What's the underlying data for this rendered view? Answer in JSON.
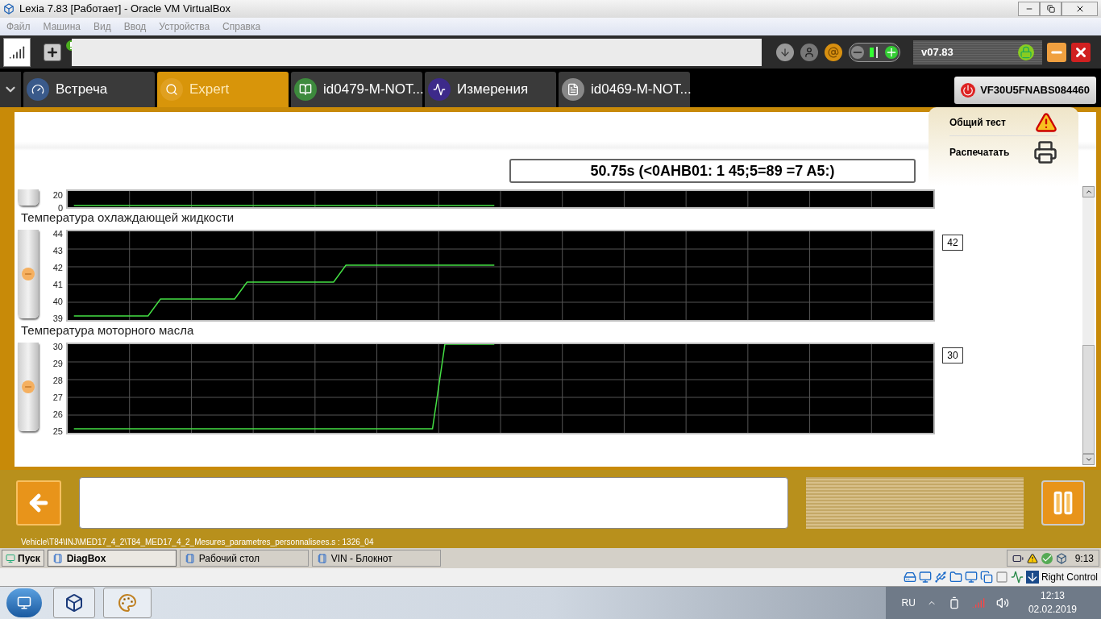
{
  "window": {
    "title": "Lexia 7.83 [Работает] - Oracle VM VirtualBox"
  },
  "menu": [
    "Файл",
    "Машина",
    "Вид",
    "Ввод",
    "Устройства",
    "Справка"
  ],
  "toolbar": {
    "version": "v07.83"
  },
  "tabs": [
    {
      "label": "Встреча",
      "selected": false
    },
    {
      "label": "Expert",
      "selected": true
    },
    {
      "label": "id0479-M-NOT...",
      "selected": false
    },
    {
      "label": "Измерения",
      "selected": false
    },
    {
      "label": "id0469-M-NOT...",
      "selected": false
    }
  ],
  "vin": "VF30U5FNABS084460",
  "actions": [
    "Общий тест",
    "Распечатать"
  ],
  "timestamp": "50.75s (<0AHB01: 1 45;5=89 =7 A5:)",
  "charts": [
    {
      "chart_data": {
        "type": "line",
        "categories": [
          null,
          null,
          null,
          null,
          null,
          null,
          null,
          null,
          null,
          null,
          null,
          null,
          null,
          null,
          null,
          null,
          null,
          null,
          null,
          null,
          null,
          null,
          null,
          null,
          null,
          null,
          null,
          null,
          null,
          null,
          null,
          null,
          null,
          null,
          null,
          null,
          null,
          null,
          null,
          null,
          null,
          null,
          null,
          null,
          null,
          null,
          null,
          null,
          null,
          null,
          null,
          null,
          null,
          null,
          null,
          null,
          null,
          null,
          null,
          null,
          null,
          null,
          null,
          null,
          null,
          null,
          null,
          null,
          null,
          null
        ],
        "ylim": [
          0,
          20
        ],
        "grid": true,
        "yticks": [
          {
            "value": 0,
            "label": "0"
          },
          {
            "value": 20,
            "label": "20"
          }
        ],
        "series": [
          {
            "color": "#44e044",
            "values": [
              0,
              0,
              0,
              0,
              0,
              0,
              0,
              0,
              0,
              0,
              0,
              0,
              0,
              0,
              0,
              0,
              0,
              0,
              0,
              0,
              0,
              0,
              0,
              0,
              0,
              0,
              0,
              0,
              0,
              0,
              0,
              0,
              0,
              0,
              0,
              null,
              null,
              null,
              null,
              null,
              null,
              null,
              null,
              null,
              null,
              null,
              null,
              null,
              null,
              null,
              null,
              null,
              null,
              null,
              null,
              null,
              null,
              null,
              null,
              null,
              null,
              null,
              null,
              null,
              null,
              null,
              null,
              null,
              null,
              null
            ]
          }
        ]
      }
    },
    {
      "reading": "42",
      "chart_data": {
        "type": "line",
        "title": "Температура охлаждающей жидкости",
        "categories": [
          null,
          null,
          null,
          null,
          null,
          null,
          null,
          null,
          null,
          null,
          null,
          null,
          null,
          null,
          null,
          null,
          null,
          null,
          null,
          null,
          null,
          null,
          null,
          null,
          null,
          null,
          null,
          null,
          null,
          null,
          null,
          null,
          null,
          null,
          null,
          null,
          null,
          null,
          null,
          null,
          null,
          null,
          null,
          null,
          null,
          null,
          null,
          null,
          null,
          null,
          null,
          null,
          null,
          null,
          null,
          null,
          null,
          null,
          null,
          null,
          null,
          null,
          null,
          null,
          null,
          null,
          null,
          null,
          null,
          null
        ],
        "ylim": [
          39,
          44
        ],
        "grid": true,
        "yticks": [
          {
            "value": 39,
            "label": "39"
          },
          {
            "value": 40,
            "label": "40"
          },
          {
            "value": 41,
            "label": "41"
          },
          {
            "value": 42,
            "label": "42"
          },
          {
            "value": 43,
            "label": "43"
          },
          {
            "value": 44,
            "label": "44"
          }
        ],
        "series": [
          {
            "color": "#44e044",
            "values": [
              39,
              39,
              39,
              39,
              39,
              39,
              39,
              40,
              40,
              40,
              40,
              40,
              40,
              40,
              41,
              41,
              41,
              41,
              41,
              41,
              41,
              41,
              42,
              42,
              42,
              42,
              42,
              42,
              42,
              42,
              42,
              42,
              42,
              42,
              42,
              null,
              null,
              null,
              null,
              null,
              null,
              null,
              null,
              null,
              null,
              null,
              null,
              null,
              null,
              null,
              null,
              null,
              null,
              null,
              null,
              null,
              null,
              null,
              null,
              null,
              null,
              null,
              null,
              null,
              null,
              null,
              null,
              null,
              null,
              null
            ]
          }
        ]
      }
    },
    {
      "reading": "30",
      "chart_data": {
        "type": "line",
        "title": "Температура моторного масла",
        "categories": [
          null,
          null,
          null,
          null,
          null,
          null,
          null,
          null,
          null,
          null,
          null,
          null,
          null,
          null,
          null,
          null,
          null,
          null,
          null,
          null,
          null,
          null,
          null,
          null,
          null,
          null,
          null,
          null,
          null,
          null,
          null,
          null,
          null,
          null,
          null,
          null,
          null,
          null,
          null,
          null,
          null,
          null,
          null,
          null,
          null,
          null,
          null,
          null,
          null,
          null,
          null,
          null,
          null,
          null,
          null,
          null,
          null,
          null,
          null,
          null,
          null,
          null,
          null,
          null,
          null,
          null,
          null,
          null,
          null,
          null
        ],
        "ylim": [
          25,
          30
        ],
        "grid": true,
        "yticks": [
          {
            "value": 25,
            "label": "25"
          },
          {
            "value": 26,
            "label": "26"
          },
          {
            "value": 27,
            "label": "27"
          },
          {
            "value": 28,
            "label": "28"
          },
          {
            "value": 29,
            "label": "29"
          },
          {
            "value": 30,
            "label": "30"
          }
        ],
        "series": [
          {
            "color": "#44e044",
            "values": [
              25,
              25,
              25,
              25,
              25,
              25,
              25,
              25,
              25,
              25,
              25,
              25,
              25,
              25,
              25,
              25,
              25,
              25,
              25,
              25,
              25,
              25,
              25,
              25,
              25,
              25,
              25,
              25,
              25,
              25,
              30,
              30,
              30,
              30,
              30,
              null,
              null,
              null,
              null,
              null,
              null,
              null,
              null,
              null,
              null,
              null,
              null,
              null,
              null,
              null,
              null,
              null,
              null,
              null,
              null,
              null,
              null,
              null,
              null,
              null,
              null,
              null,
              null,
              null,
              null,
              null,
              null,
              null,
              null,
              null
            ]
          }
        ]
      }
    }
  ],
  "path": "Vehicle\\T84\\INJ\\MED17_4_2\\T84_MED17_4_2_Mesures_parametres_personnalisees.s : 1326_04",
  "xp_taskbar": {
    "start": "Пуск",
    "items": [
      {
        "label": "DiagBox",
        "selected": true
      },
      {
        "label": "Рабочий стол",
        "selected": false
      },
      {
        "label": "VIN - Блокнот",
        "selected": false
      }
    ],
    "clock": "9:13"
  },
  "vbox_status": {
    "host_key": "Right Control"
  },
  "win7_taskbar": {
    "lang": "RU",
    "time": "12:13",
    "date": "02.02.2019"
  }
}
